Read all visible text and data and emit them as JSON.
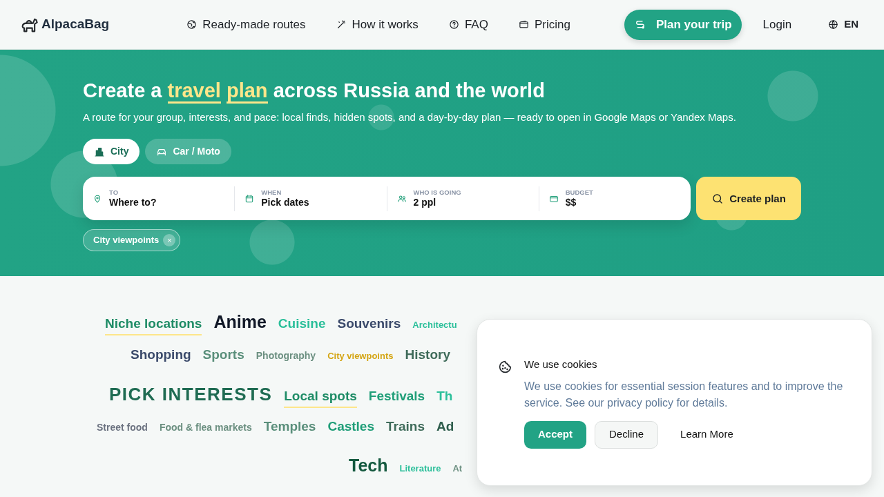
{
  "header": {
    "logo": "AlpacaBag",
    "nav": [
      {
        "label": "Ready-made routes"
      },
      {
        "label": "How it works"
      },
      {
        "label": "FAQ"
      },
      {
        "label": "Pricing"
      }
    ],
    "cta": "Plan your trip",
    "login": "Login",
    "language": "EN"
  },
  "hero": {
    "title": {
      "before": "Create a",
      "highlight": [
        "travel",
        "plan"
      ],
      "after": "across Russia and the world"
    },
    "subtitle": "A route for your group, interests, and pace: local finds, hidden spots, and a day-by-day plan — ready to open in Google Maps or Yandex Maps.",
    "modes": [
      {
        "label": "City",
        "selected": true
      },
      {
        "label": "Car / Moto",
        "selected": false
      }
    ],
    "fields": [
      {
        "label": "TO",
        "value": "Where to?"
      },
      {
        "label": "WHEN",
        "value": "Pick dates"
      },
      {
        "label": "WHO IS GOING",
        "value": "2 ppl"
      },
      {
        "label": "BUDGET",
        "value": "$$"
      }
    ],
    "submit": "Create plan",
    "chips": [
      {
        "label": "City viewpoints",
        "remove": "×"
      }
    ]
  },
  "interests": [
    [
      {
        "label": "Niche locations",
        "kind": "medium",
        "color": "#1e8c66",
        "highlighted": true
      },
      {
        "label": "Anime",
        "kind": "large",
        "color": "#111827",
        "highlighted": false
      },
      {
        "label": "Cuisine",
        "kind": "medium",
        "color": "#2bbf9a",
        "highlighted": false
      },
      {
        "label": "Souvenirs",
        "kind": "medium",
        "color": "#3b4a6b",
        "highlighted": false
      },
      {
        "label": "Architectu",
        "kind": "small",
        "color": "#2bbf9a",
        "highlighted": false
      }
    ],
    [
      {
        "label": "Shopping",
        "kind": "medium",
        "color": "#3b4a6b",
        "highlighted": false
      },
      {
        "label": "Sports",
        "kind": "medium",
        "color": "#5a8f7b",
        "highlighted": false
      },
      {
        "label": "Photography",
        "kind": "regular",
        "color": "#6b8f80",
        "highlighted": false
      },
      {
        "label": "City viewpoints",
        "kind": "small",
        "color": "#d4a514",
        "highlighted": false
      },
      {
        "label": "History",
        "kind": "medium",
        "color": "#3f6b5a",
        "highlighted": false
      }
    ],
    [
      {
        "label": "PICK INTERESTS",
        "kind": "headline",
        "color": "#1f6b52",
        "highlighted": false
      },
      {
        "label": "Local spots",
        "kind": "medium",
        "color": "#1e8c66",
        "highlighted": true
      },
      {
        "label": "Festivals",
        "kind": "medium",
        "color": "#1f9e78",
        "highlighted": false
      },
      {
        "label": "Th",
        "kind": "medium",
        "color": "#2bbf9a",
        "highlighted": false
      }
    ],
    [
      {
        "label": "Street food",
        "kind": "regular",
        "color": "#6b7280",
        "highlighted": false
      },
      {
        "label": "Food & flea markets",
        "kind": "regular",
        "color": "#6b8f80",
        "highlighted": false
      },
      {
        "label": "Temples",
        "kind": "medium",
        "color": "#5a8f7b",
        "highlighted": false
      },
      {
        "label": "Castles",
        "kind": "medium",
        "color": "#1f9e78",
        "highlighted": false
      },
      {
        "label": "Trains",
        "kind": "medium",
        "color": "#3f6b5a",
        "highlighted": false
      },
      {
        "label": "Ad",
        "kind": "medium",
        "color": "#2f5e4d",
        "highlighted": false
      }
    ],
    [
      {
        "label": "Tech",
        "kind": "large",
        "color": "#14593f",
        "highlighted": false
      },
      {
        "label": "Literature",
        "kind": "small",
        "color": "#2bbf9a",
        "highlighted": false
      },
      {
        "label": "At",
        "kind": "small",
        "color": "#6b8f80",
        "highlighted": false
      }
    ]
  ],
  "cookie_banner": {
    "title": "We use cookies",
    "text": "We use cookies for essential session features and to improve the service. See our privacy policy for details.",
    "buttons": [
      {
        "label": "Accept",
        "kind": "primary"
      },
      {
        "label": "Decline",
        "kind": "secondary"
      },
      {
        "label": "Learn More",
        "kind": "link"
      }
    ]
  }
}
